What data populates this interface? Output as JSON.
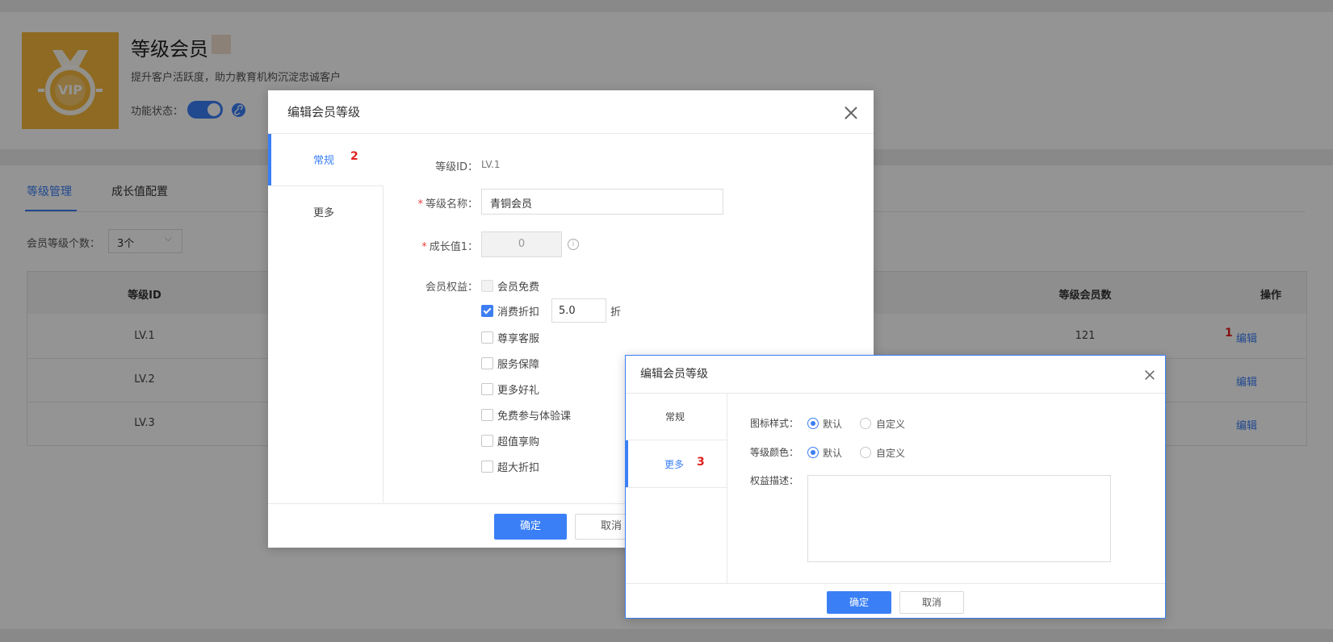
{
  "header": {
    "title": "等级会员",
    "subtitle": "提升客户活跃度，助力教育机构沉淀忠诚客户",
    "status_label": "功能状态：",
    "vip_badge": "VIP",
    "toggle_on": true
  },
  "tabs": [
    {
      "label": "等级管理",
      "active": true
    },
    {
      "label": "成长值配置",
      "active": false
    }
  ],
  "filter": {
    "label": "会员等级个数：",
    "value": "3个"
  },
  "table": {
    "headers": [
      "等级ID",
      "等级会员数",
      "操作"
    ],
    "rows": [
      {
        "id": "LV.1",
        "count": "121",
        "action": "编辑"
      },
      {
        "id": "LV.2",
        "count": "",
        "action": "编辑"
      },
      {
        "id": "LV.3",
        "count": "",
        "action": "编辑"
      }
    ]
  },
  "markers": {
    "m1": "1",
    "m2": "2",
    "m3": "3"
  },
  "dialog1": {
    "title": "编辑会员等级",
    "tabs": [
      "常规",
      "更多"
    ],
    "level_id_label": "等级ID：",
    "level_id_value": "LV.1",
    "name_label": "等级名称：",
    "name_value": "青铜会员",
    "growth_label": "成长值1：",
    "growth_value": "0",
    "benefits_label": "会员权益：",
    "benefits": [
      {
        "label": "会员免费",
        "state": "disabled"
      },
      {
        "label": "消费折扣",
        "state": "checked"
      },
      {
        "label": "尊享客服",
        "state": "unchecked"
      },
      {
        "label": "服务保障",
        "state": "unchecked"
      },
      {
        "label": "更多好礼",
        "state": "unchecked"
      },
      {
        "label": "免费参与体验课",
        "state": "unchecked"
      },
      {
        "label": "超值享购",
        "state": "unchecked"
      },
      {
        "label": "超大折扣",
        "state": "unchecked"
      }
    ],
    "discount_value": "5.0",
    "discount_unit": "折",
    "confirm": "确定",
    "cancel": "取消"
  },
  "dialog2": {
    "title": "编辑会员等级",
    "tabs": [
      "常规",
      "更多"
    ],
    "icon_style_label": "图标样式：",
    "level_color_label": "等级颜色：",
    "option_default": "默认",
    "option_custom": "自定义",
    "desc_label": "权益描述：",
    "confirm": "确定",
    "cancel": "取消"
  },
  "colors": {
    "primary": "#3a7ff6",
    "marker": "#e02020"
  }
}
